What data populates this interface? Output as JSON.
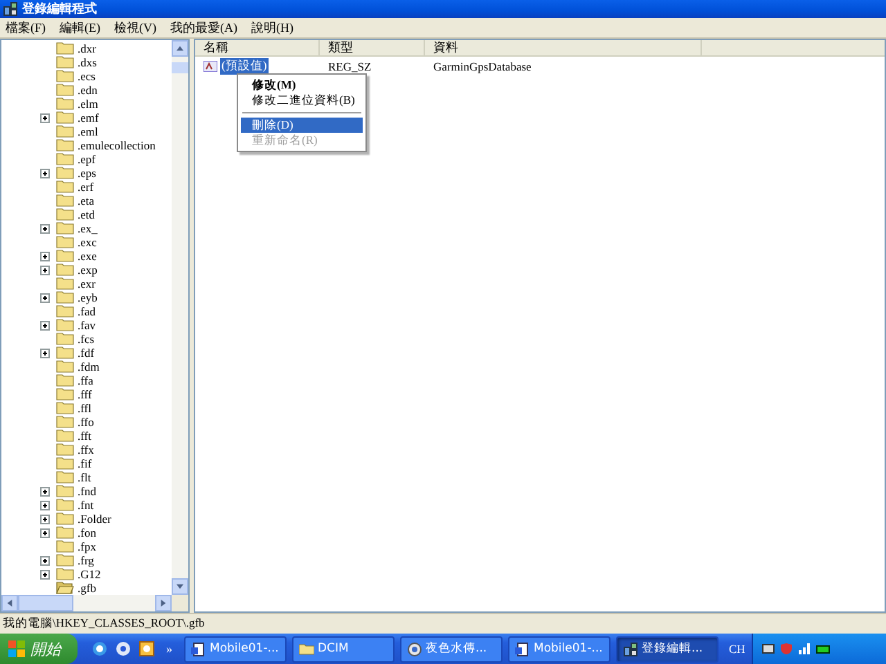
{
  "window": {
    "title": "登錄編輯程式"
  },
  "menu_bar": [
    "檔案(F)",
    "編輯(E)",
    "檢視(V)",
    "我的最愛(A)",
    "說明(H)"
  ],
  "tree": {
    "items": [
      {
        "label": ".dxr",
        "has_children": false,
        "selected": false
      },
      {
        "label": ".dxs",
        "has_children": false,
        "selected": false
      },
      {
        "label": ".ecs",
        "has_children": false,
        "selected": false
      },
      {
        "label": ".edn",
        "has_children": false,
        "selected": false
      },
      {
        "label": ".elm",
        "has_children": false,
        "selected": false
      },
      {
        "label": ".emf",
        "has_children": true,
        "selected": false
      },
      {
        "label": ".eml",
        "has_children": false,
        "selected": false
      },
      {
        "label": ".emulecollection",
        "has_children": false,
        "selected": false
      },
      {
        "label": ".epf",
        "has_children": false,
        "selected": false
      },
      {
        "label": ".eps",
        "has_children": true,
        "selected": false
      },
      {
        "label": ".erf",
        "has_children": false,
        "selected": false
      },
      {
        "label": ".eta",
        "has_children": false,
        "selected": false
      },
      {
        "label": ".etd",
        "has_children": false,
        "selected": false
      },
      {
        "label": ".ex_",
        "has_children": true,
        "selected": false
      },
      {
        "label": ".exc",
        "has_children": false,
        "selected": false
      },
      {
        "label": ".exe",
        "has_children": true,
        "selected": false
      },
      {
        "label": ".exp",
        "has_children": true,
        "selected": false
      },
      {
        "label": ".exr",
        "has_children": false,
        "selected": false
      },
      {
        "label": ".eyb",
        "has_children": true,
        "selected": false
      },
      {
        "label": ".fad",
        "has_children": false,
        "selected": false
      },
      {
        "label": ".fav",
        "has_children": true,
        "selected": false
      },
      {
        "label": ".fcs",
        "has_children": false,
        "selected": false
      },
      {
        "label": ".fdf",
        "has_children": true,
        "selected": false
      },
      {
        "label": ".fdm",
        "has_children": false,
        "selected": false
      },
      {
        "label": ".ffa",
        "has_children": false,
        "selected": false
      },
      {
        "label": ".fff",
        "has_children": false,
        "selected": false
      },
      {
        "label": ".ffl",
        "has_children": false,
        "selected": false
      },
      {
        "label": ".ffo",
        "has_children": false,
        "selected": false
      },
      {
        "label": ".fft",
        "has_children": false,
        "selected": false
      },
      {
        "label": ".ffx",
        "has_children": false,
        "selected": false
      },
      {
        "label": ".fif",
        "has_children": false,
        "selected": false
      },
      {
        "label": ".flt",
        "has_children": false,
        "selected": false
      },
      {
        "label": ".fnd",
        "has_children": true,
        "selected": false
      },
      {
        "label": ".fnt",
        "has_children": true,
        "selected": false
      },
      {
        "label": ".Folder",
        "has_children": true,
        "selected": false
      },
      {
        "label": ".fon",
        "has_children": true,
        "selected": false
      },
      {
        "label": ".fpx",
        "has_children": false,
        "selected": false
      },
      {
        "label": ".frg",
        "has_children": true,
        "selected": false
      },
      {
        "label": ".G12",
        "has_children": true,
        "selected": false
      },
      {
        "label": ".gfb",
        "has_children": false,
        "selected": true
      }
    ]
  },
  "values": {
    "columns": [
      "名稱",
      "類型",
      "資料"
    ],
    "rows": [
      {
        "name": "(預設值)",
        "type": "REG_SZ",
        "data": "GarminGpsDatabase",
        "selected": true
      }
    ]
  },
  "context_menu": [
    {
      "label": "修改(M)",
      "kind": "default",
      "highlighted": false,
      "disabled": false
    },
    {
      "label": "修改二進位資料(B)",
      "kind": "item",
      "highlighted": false,
      "disabled": false
    },
    {
      "kind": "separator"
    },
    {
      "label": "刪除(D)",
      "kind": "item",
      "highlighted": true,
      "disabled": false
    },
    {
      "label": "重新命名(R)",
      "kind": "item",
      "highlighted": false,
      "disabled": true
    }
  ],
  "status_bar": "我的電腦\\HKEY_CLASSES_ROOT\\.gfb",
  "taskbar": {
    "start": "開始",
    "more": "»",
    "buttons": [
      {
        "label": "Mobile01-...",
        "kind": "doc",
        "selected": false
      },
      {
        "label": "DCIM",
        "kind": "folder",
        "selected": false
      },
      {
        "label": "夜色水傳...",
        "kind": "app",
        "selected": false
      },
      {
        "label": "Mobile01-...",
        "kind": "doc",
        "selected": false
      },
      {
        "label": "登錄編輯...",
        "kind": "regedit",
        "selected": true
      }
    ],
    "language": "CH"
  }
}
